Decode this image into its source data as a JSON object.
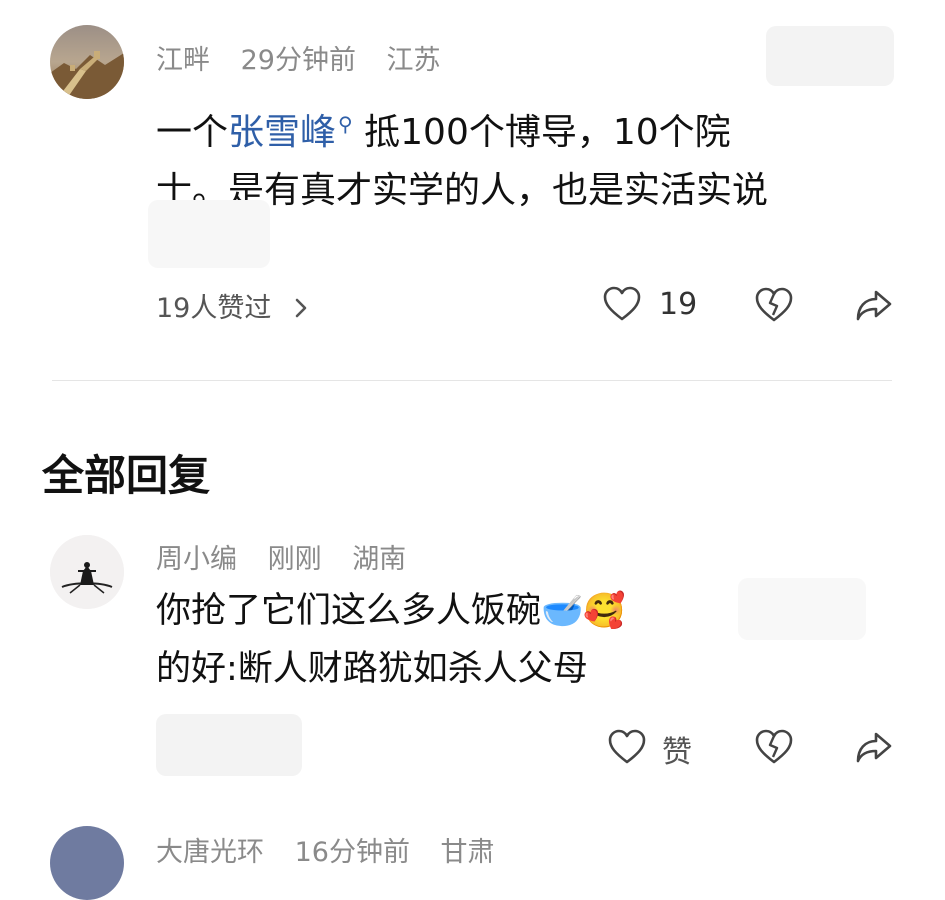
{
  "top_comment": {
    "author": "江畔",
    "time": "29分钟前",
    "location": "江苏",
    "text_prefix": "一个",
    "mention": "张雪峰",
    "text_after_mention": "抵100个博导，10个院",
    "text_line2": "士。是有真才实学的人，也是实活实说",
    "likers_text": "19人赞过",
    "like_count": "19"
  },
  "section": {
    "title": "全部回复"
  },
  "reply": {
    "author": "周小编",
    "time": "刚刚",
    "location": "湖南",
    "text_line1": "你抢了它们这么多人饭碗",
    "emoji_bowl": "🥣",
    "emoji_face": "🥰",
    "text_line2": "的好:断人财路犹如杀人父母",
    "like_label": "赞"
  },
  "next_comment": {
    "author": "大唐光环",
    "time": "16分钟前",
    "location": "甘肃"
  },
  "colors": {
    "mention": "#2f5fa8",
    "meta_gray": "#8a8a8a",
    "text": "#111111"
  },
  "icons": {
    "like": "heart-outline-icon",
    "dislike": "broken-heart-icon",
    "share": "share-arrow-icon",
    "chevron": "chevron-right-icon",
    "mention_search": "search-icon"
  }
}
